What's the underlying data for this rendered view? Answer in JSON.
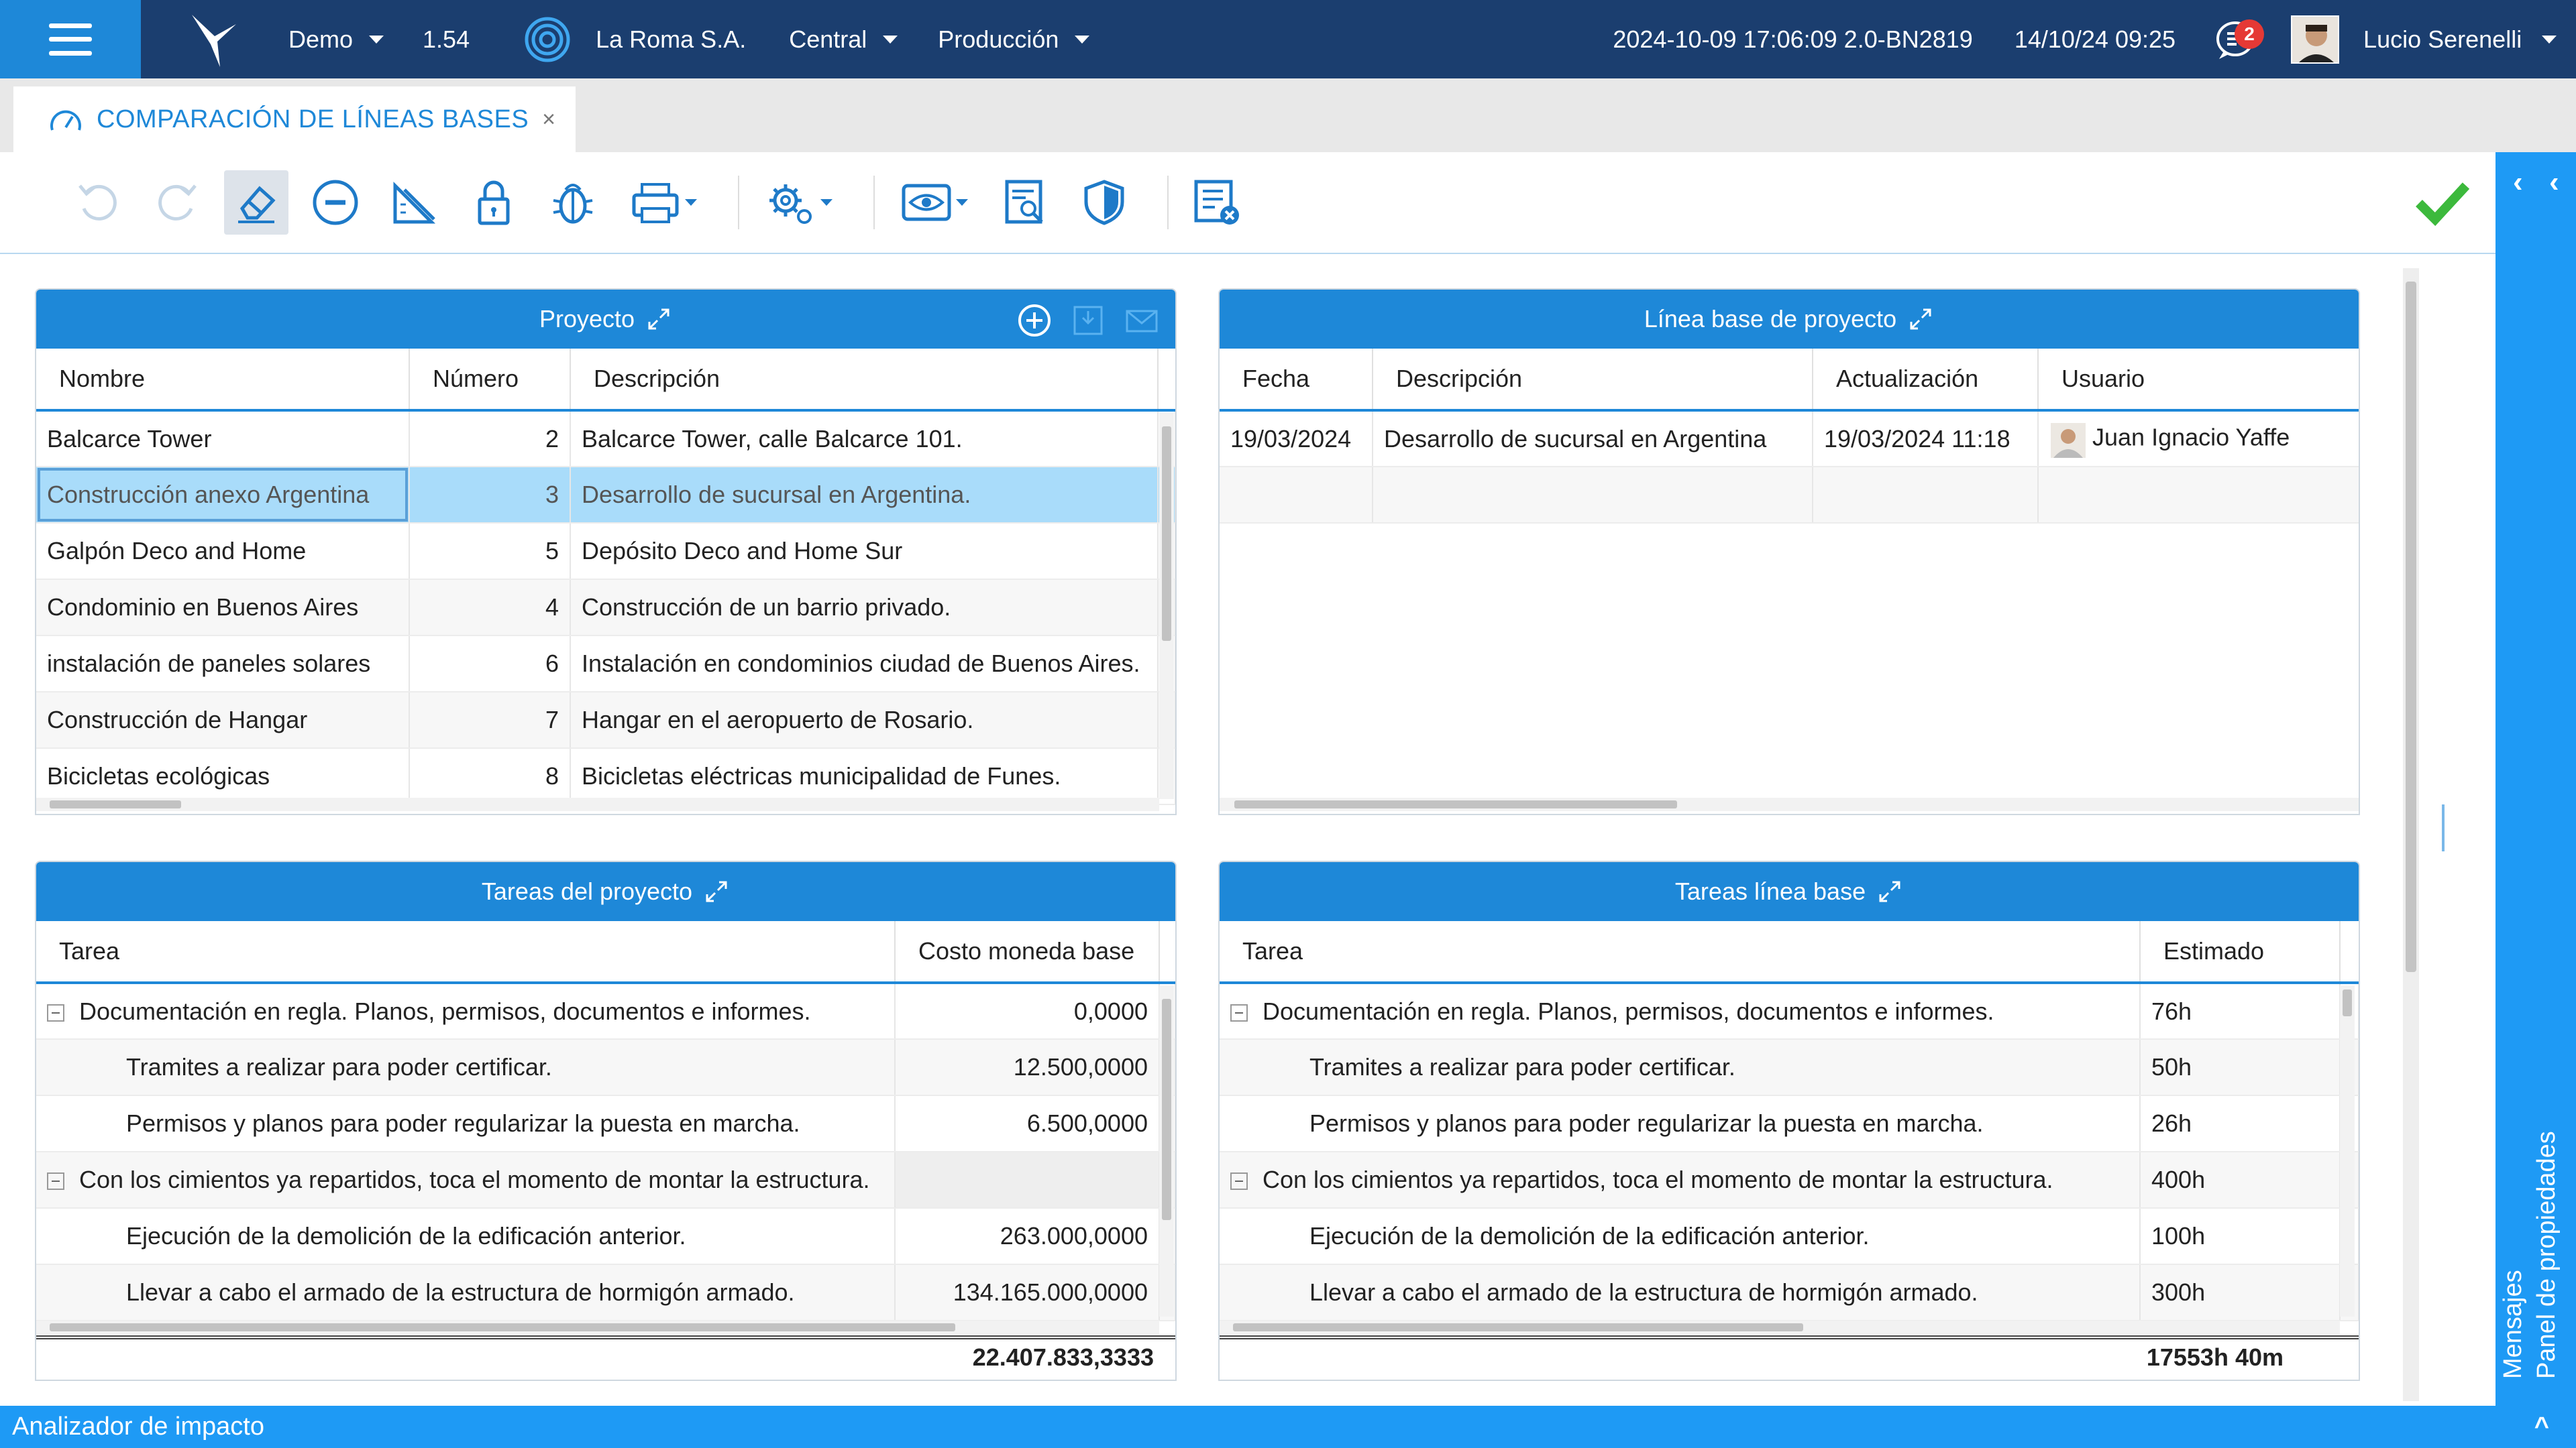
{
  "topbar": {
    "env": "Demo",
    "version": "1.54",
    "company": "La Roma S.A.",
    "branch": "Central",
    "stage": "Producción",
    "build": "2024-10-09 17:06:09 2.0-BN2819",
    "datetime": "14/10/24 09:25",
    "notifications": "2",
    "user": "Lucio Serenelli"
  },
  "tab": {
    "label": "COMPARACIÓN DE LÍNEAS BASES",
    "close": "×"
  },
  "colors": {
    "primary": "#1e88d8",
    "topbar": "#1b3e6f",
    "panel": "#1e9af5",
    "selected": "#a9dcfa",
    "ok": "#3cb93c"
  },
  "toolbar": {
    "icons": [
      "undo-icon",
      "redo-icon",
      "eraser-icon",
      "minus-circle-icon",
      "ruler-pencil-icon",
      "lock-icon",
      "bug-icon",
      "print-icon",
      "settings-icon",
      "view-icon",
      "report-search-icon",
      "shield-icon",
      "list-cancel-icon",
      "check-icon"
    ]
  },
  "right_panel": {
    "properties": "Panel de propiedades",
    "messages": "Mensajes"
  },
  "bottom_bar": {
    "label": "Analizador de impacto"
  },
  "proyecto": {
    "title": "Proyecto",
    "columns": [
      "Nombre",
      "Número",
      "Descripción"
    ],
    "rows": [
      {
        "nombre": "Balcarce Tower",
        "numero": "2",
        "descripcion": "Balcarce Tower, calle Balcarce 101."
      },
      {
        "nombre": "Construcción anexo Argentina",
        "numero": "3",
        "descripcion": "Desarrollo de sucursal en Argentina."
      },
      {
        "nombre": "Galpón Deco and Home",
        "numero": "5",
        "descripcion": "Depósito Deco and Home Sur"
      },
      {
        "nombre": "Condominio en Buenos Aires",
        "numero": "4",
        "descripcion": "Construcción de un barrio privado."
      },
      {
        "nombre": "instalación de paneles solares",
        "numero": "6",
        "descripcion": "Instalación en condominios ciudad de Buenos Aires."
      },
      {
        "nombre": "Construcción de Hangar",
        "numero": "7",
        "descripcion": "Hangar en el aeropuerto de Rosario."
      },
      {
        "nombre": "Bicicletas ecológicas",
        "numero": "8",
        "descripcion": "Bicicletas eléctricas municipalidad de Funes."
      }
    ]
  },
  "linea_base": {
    "title": "Línea base de proyecto",
    "columns": [
      "Fecha",
      "Descripción",
      "Actualización",
      "Usuario"
    ],
    "rows": [
      {
        "fecha": "19/03/2024",
        "descripcion": "Desarrollo de sucursal en Argentina",
        "actualizacion": "19/03/2024 11:18",
        "usuario": "Juan Ignacio Yaffe"
      }
    ]
  },
  "tareas_proyecto": {
    "title": "Tareas del proyecto",
    "columns": [
      "Tarea",
      "Costo moneda base"
    ],
    "rows": [
      {
        "tarea": "Documentación en regla. Planos, permisos, documentos e informes.",
        "valor": "0,0000"
      },
      {
        "tarea": "Tramites a realizar para poder certificar.",
        "valor": "12.500,0000"
      },
      {
        "tarea": "Permisos y planos para poder regularizar la puesta en marcha.",
        "valor": "6.500,0000"
      },
      {
        "tarea": "Con los cimientos ya repartidos, toca el momento de montar la estructura.",
        "valor": ""
      },
      {
        "tarea": "Ejecución de la demolición de la edificación anterior.",
        "valor": "263.000,0000"
      },
      {
        "tarea": "Llevar a cabo el armado de la estructura de hormigón armado.",
        "valor": "134.165.000,0000"
      }
    ],
    "total": "22.407.833,3333"
  },
  "tareas_linea": {
    "title": "Tareas línea base",
    "columns": [
      "Tarea",
      "Estimado"
    ],
    "rows": [
      {
        "tarea": "Documentación en regla. Planos, permisos, documentos e informes.",
        "valor": "76h"
      },
      {
        "tarea": "Tramites a realizar para poder certificar.",
        "valor": "50h"
      },
      {
        "tarea": "Permisos y planos para poder regularizar la puesta en marcha.",
        "valor": "26h"
      },
      {
        "tarea": "Con los cimientos ya repartidos, toca el momento de montar la estructura.",
        "valor": "400h"
      },
      {
        "tarea": "Ejecución de la demolición de la edificación anterior.",
        "valor": "100h"
      },
      {
        "tarea": "Llevar a cabo el armado de la estructura de hormigón armado.",
        "valor": "300h"
      }
    ],
    "total": "17553h 40m"
  }
}
